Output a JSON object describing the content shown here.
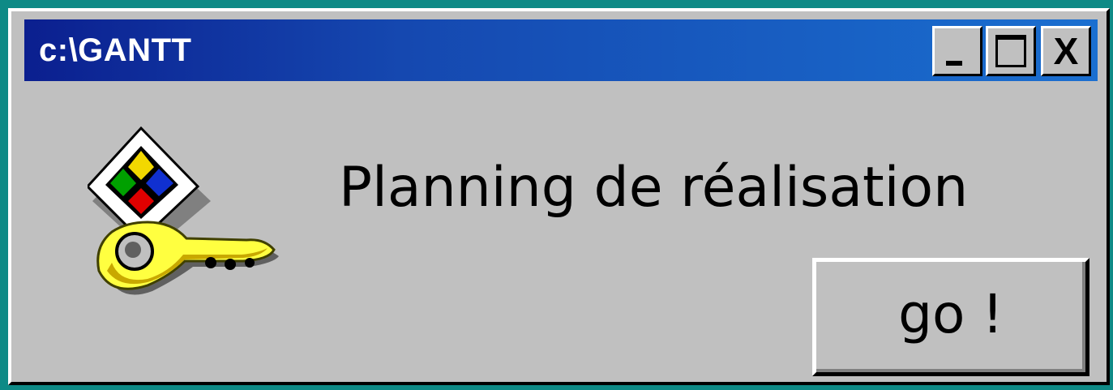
{
  "window": {
    "title": "c:\\GANTT",
    "controls": {
      "minimize_icon": "minimize-icon",
      "maximize_icon": "maximize-icon",
      "close_label": "X"
    }
  },
  "dialog": {
    "icon": "key-icon",
    "message": "Planning de réalisation",
    "go_label": "go !"
  },
  "colors": {
    "desktop": "#0e8a86",
    "titlebar_start": "#0b1f8f",
    "titlebar_end": "#1a6fd0",
    "face": "#c0c0c0"
  }
}
